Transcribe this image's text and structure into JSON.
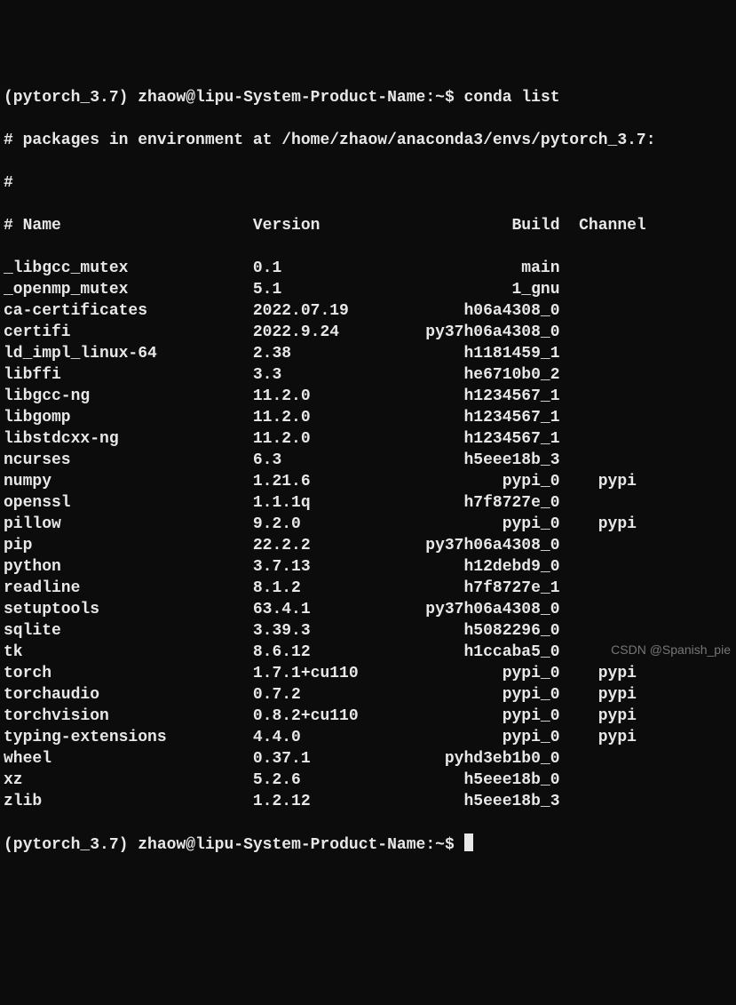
{
  "prompt_env": "(pytorch_3.7)",
  "prompt_userhost": "zhaow@lipu-System-Product-Name",
  "prompt_path": "~",
  "command": "conda list",
  "env_comment": "# packages in environment at /home/zhaow/anaconda3/envs/pytorch_3.7:",
  "hash_line": "#",
  "header": {
    "name": "# Name",
    "version": "Version",
    "build": "Build",
    "channel": "Channel"
  },
  "packages": [
    {
      "name": "_libgcc_mutex",
      "version": "0.1",
      "build": "main",
      "channel": ""
    },
    {
      "name": "_openmp_mutex",
      "version": "5.1",
      "build": "1_gnu",
      "channel": ""
    },
    {
      "name": "ca-certificates",
      "version": "2022.07.19",
      "build": "h06a4308_0",
      "channel": ""
    },
    {
      "name": "certifi",
      "version": "2022.9.24",
      "build": "py37h06a4308_0",
      "channel": ""
    },
    {
      "name": "ld_impl_linux-64",
      "version": "2.38",
      "build": "h1181459_1",
      "channel": ""
    },
    {
      "name": "libffi",
      "version": "3.3",
      "build": "he6710b0_2",
      "channel": ""
    },
    {
      "name": "libgcc-ng",
      "version": "11.2.0",
      "build": "h1234567_1",
      "channel": ""
    },
    {
      "name": "libgomp",
      "version": "11.2.0",
      "build": "h1234567_1",
      "channel": ""
    },
    {
      "name": "libstdcxx-ng",
      "version": "11.2.0",
      "build": "h1234567_1",
      "channel": ""
    },
    {
      "name": "ncurses",
      "version": "6.3",
      "build": "h5eee18b_3",
      "channel": ""
    },
    {
      "name": "numpy",
      "version": "1.21.6",
      "build": "pypi_0",
      "channel": "pypi"
    },
    {
      "name": "openssl",
      "version": "1.1.1q",
      "build": "h7f8727e_0",
      "channel": ""
    },
    {
      "name": "pillow",
      "version": "9.2.0",
      "build": "pypi_0",
      "channel": "pypi"
    },
    {
      "name": "pip",
      "version": "22.2.2",
      "build": "py37h06a4308_0",
      "channel": ""
    },
    {
      "name": "python",
      "version": "3.7.13",
      "build": "h12debd9_0",
      "channel": ""
    },
    {
      "name": "readline",
      "version": "8.1.2",
      "build": "h7f8727e_1",
      "channel": ""
    },
    {
      "name": "setuptools",
      "version": "63.4.1",
      "build": "py37h06a4308_0",
      "channel": ""
    },
    {
      "name": "sqlite",
      "version": "3.39.3",
      "build": "h5082296_0",
      "channel": ""
    },
    {
      "name": "tk",
      "version": "8.6.12",
      "build": "h1ccaba5_0",
      "channel": ""
    },
    {
      "name": "torch",
      "version": "1.7.1+cu110",
      "build": "pypi_0",
      "channel": "pypi"
    },
    {
      "name": "torchaudio",
      "version": "0.7.2",
      "build": "pypi_0",
      "channel": "pypi"
    },
    {
      "name": "torchvision",
      "version": "0.8.2+cu110",
      "build": "pypi_0",
      "channel": "pypi"
    },
    {
      "name": "typing-extensions",
      "version": "4.4.0",
      "build": "pypi_0",
      "channel": "pypi"
    },
    {
      "name": "wheel",
      "version": "0.37.1",
      "build": "pyhd3eb1b0_0",
      "channel": ""
    },
    {
      "name": "xz",
      "version": "5.2.6",
      "build": "h5eee18b_0",
      "channel": ""
    },
    {
      "name": "zlib",
      "version": "1.2.12",
      "build": "h5eee18b_3",
      "channel": ""
    }
  ],
  "watermark": "CSDN @Spanish_pie"
}
